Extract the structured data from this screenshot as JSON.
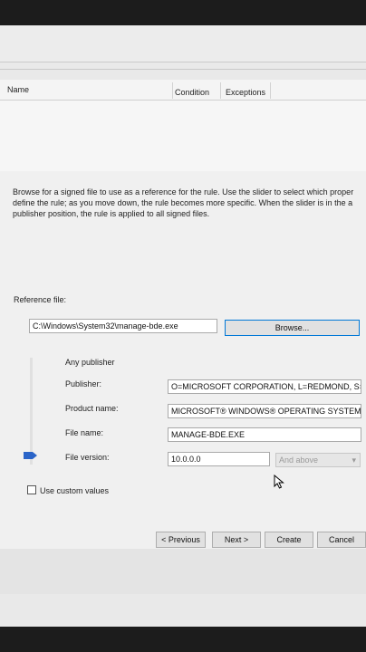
{
  "list_header": {
    "col_name": "Name",
    "col_condition": "Condition",
    "col_exceptions": "Exceptions"
  },
  "description": {
    "line1": "Browse for a signed file to use as a reference for the rule. Use the slider to select which proper",
    "line2": "define the rule; as you move down, the rule becomes more specific. When the slider is in the a",
    "line3": "publisher position, the rule is applied to all signed files."
  },
  "reference": {
    "label": "Reference file:",
    "value": "C:\\Windows\\System32\\manage-bde.exe",
    "browse_label": "Browse..."
  },
  "levels": {
    "any_publisher": "Any publisher",
    "publisher_label": "Publisher:",
    "publisher_value": "O=MICROSOFT CORPORATION, L=REDMOND, S=V",
    "product_label": "Product name:",
    "product_value": "MICROSOFT® WINDOWS® OPERATING SYSTEM",
    "filename_label": "File name:",
    "filename_value": "MANAGE-BDE.EXE",
    "version_label": "File version:",
    "version_value": "10.0.0.0",
    "version_mode": "And above",
    "slider_level": "File version"
  },
  "custom": {
    "label": "Use custom values",
    "checked": false
  },
  "buttons": {
    "previous": "< Previous",
    "next": "Next >",
    "create": "Create",
    "cancel": "Cancel"
  },
  "colors": {
    "accent": "#0078d7",
    "slider_thumb": "#2a64c8"
  }
}
